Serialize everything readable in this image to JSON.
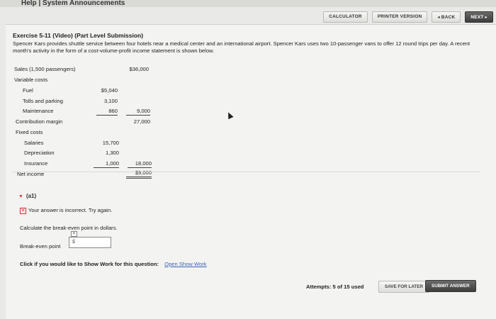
{
  "header": {
    "help": "Help",
    "separator": "|",
    "announcements": "System Announcements"
  },
  "nav": {
    "calculator": "CALCULATOR",
    "printer": "PRINTER VERSION",
    "back": "◂ BACK",
    "next": "NEXT ▸"
  },
  "exercise": {
    "title": "Exercise 5-11 (Video) (Part Level Submission)",
    "description": "Spencer Kars provides shuttle service between four hotels near a medical center and an international airport. Spencer Kars uses two 10-passenger vans to offer 12 round trips per day. A recent month's activity in the form of a cost-volume-profit income statement is shown below."
  },
  "statement": {
    "sales_label": "Sales (1,500 passengers)",
    "sales_value": "$36,000",
    "variable_label": "Variable costs",
    "fuel_label": "Fuel",
    "fuel_value": "$5,040",
    "tolls_label": "Tolls and parking",
    "tolls_value": "3,100",
    "maint_label": "Maintenance",
    "maint_value": "860",
    "variable_total": "9,000",
    "cm_label": "Contribution margin",
    "cm_value": "27,000",
    "fixed_label": "Fixed costs",
    "salaries_label": "Salaries",
    "salaries_value": "15,700",
    "dep_label": "Depreciation",
    "dep_value": "1,300",
    "ins_label": "Insurance",
    "ins_value": "1,000",
    "fixed_total": "18,000",
    "ni_label": "Net income",
    "ni_value": "$9,000"
  },
  "part": {
    "label": "(a1)",
    "incorrect": "Your answer is incorrect.  Try again.",
    "instruction": "Calculate the break-even point in dollars.",
    "be_label": "Break-even point",
    "be_prefix": "$",
    "showwork_prompt": "Click if you would like to Show Work for this question:",
    "showwork_link": "Open Show Work"
  },
  "footer": {
    "attempts": "Attempts: 5 of 15 used",
    "save": "SAVE FOR LATER",
    "submit": "SUBMIT ANSWER"
  }
}
